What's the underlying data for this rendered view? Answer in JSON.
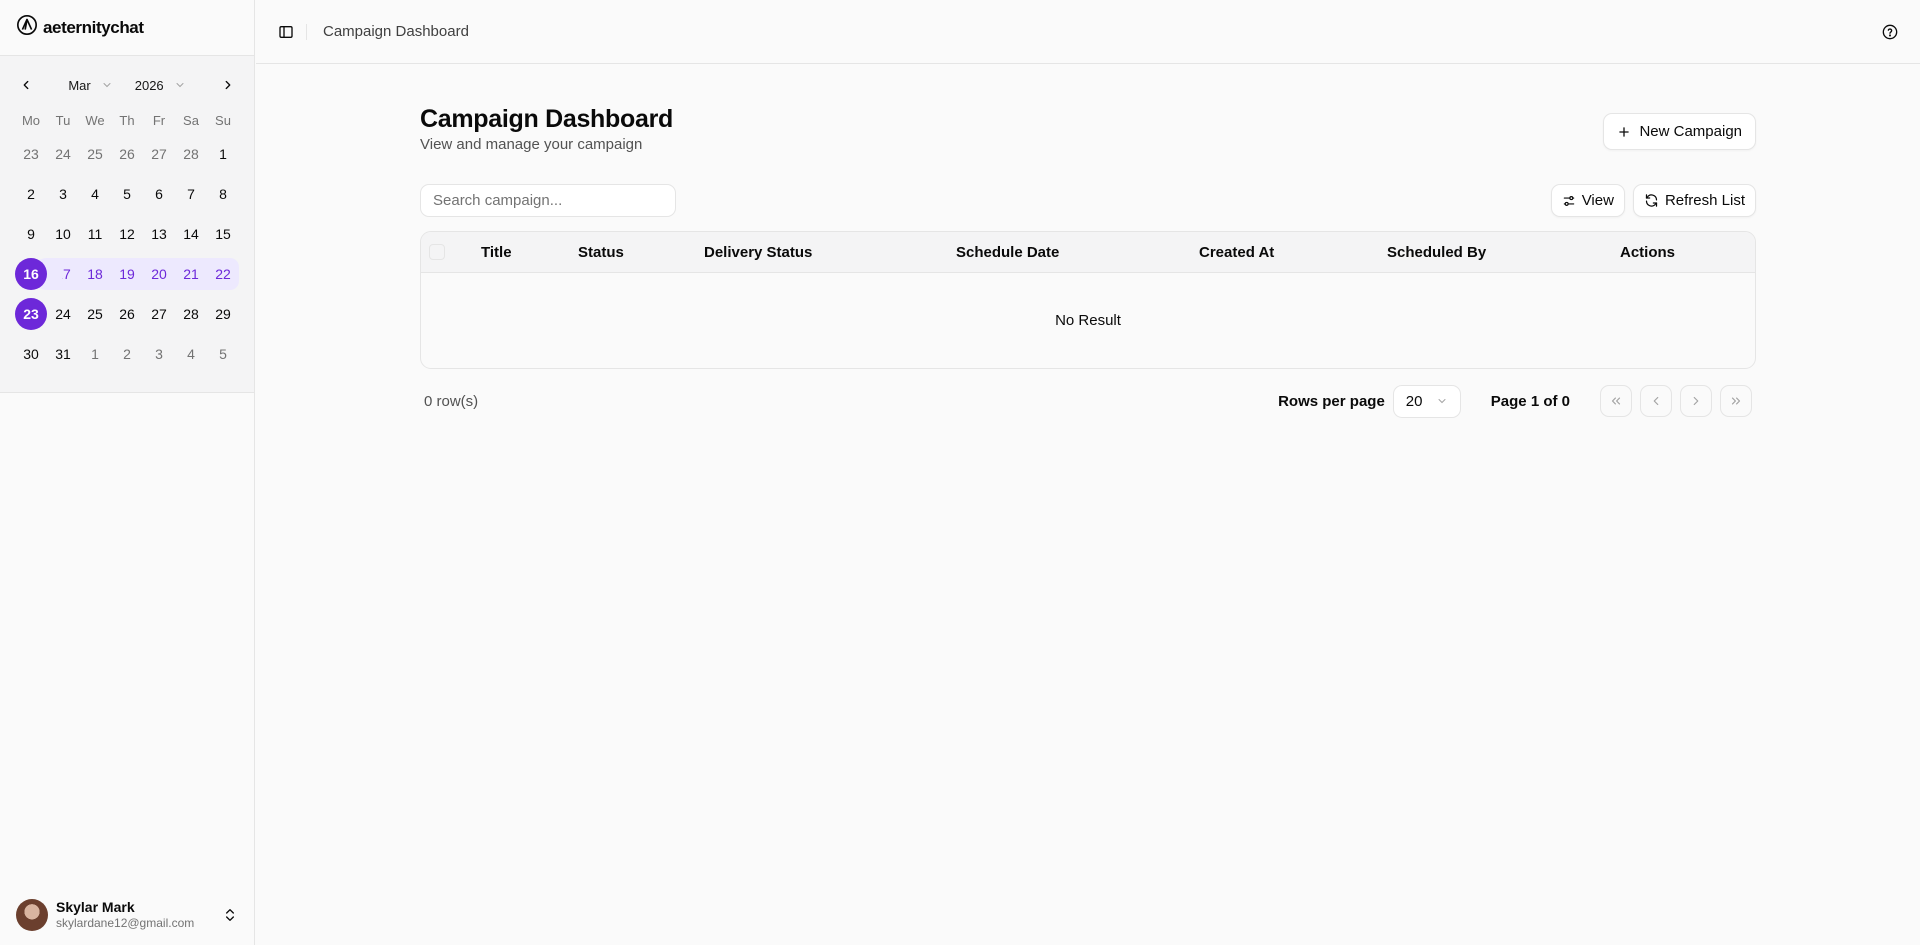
{
  "brand": {
    "name": "aeternitychat"
  },
  "calendar": {
    "month": "Mar",
    "year": "2026",
    "weekdays": [
      "Mo",
      "Tu",
      "We",
      "Th",
      "Fr",
      "Sa",
      "Su"
    ],
    "days": [
      {
        "d": "23",
        "t": "muted"
      },
      {
        "d": "24",
        "t": "muted"
      },
      {
        "d": "25",
        "t": "muted"
      },
      {
        "d": "26",
        "t": "muted"
      },
      {
        "d": "27",
        "t": "muted"
      },
      {
        "d": "28",
        "t": "muted"
      },
      {
        "d": "1",
        "t": ""
      },
      {
        "d": "2",
        "t": ""
      },
      {
        "d": "3",
        "t": ""
      },
      {
        "d": "4",
        "t": ""
      },
      {
        "d": "5",
        "t": ""
      },
      {
        "d": "6",
        "t": ""
      },
      {
        "d": "7",
        "t": ""
      },
      {
        "d": "8",
        "t": ""
      },
      {
        "d": "9",
        "t": ""
      },
      {
        "d": "10",
        "t": ""
      },
      {
        "d": "11",
        "t": ""
      },
      {
        "d": "12",
        "t": ""
      },
      {
        "d": "13",
        "t": ""
      },
      {
        "d": "14",
        "t": ""
      },
      {
        "d": "15",
        "t": ""
      },
      {
        "d": "16",
        "t": "sel range-start"
      },
      {
        "d": "17",
        "t": "range"
      },
      {
        "d": "18",
        "t": "range"
      },
      {
        "d": "19",
        "t": "range"
      },
      {
        "d": "20",
        "t": "range"
      },
      {
        "d": "21",
        "t": "range"
      },
      {
        "d": "22",
        "t": "range range-end"
      },
      {
        "d": "23",
        "t": "sel"
      },
      {
        "d": "24",
        "t": ""
      },
      {
        "d": "25",
        "t": ""
      },
      {
        "d": "26",
        "t": ""
      },
      {
        "d": "27",
        "t": ""
      },
      {
        "d": "28",
        "t": ""
      },
      {
        "d": "29",
        "t": ""
      },
      {
        "d": "30",
        "t": ""
      },
      {
        "d": "31",
        "t": ""
      },
      {
        "d": "1",
        "t": "muted"
      },
      {
        "d": "2",
        "t": "muted"
      },
      {
        "d": "3",
        "t": "muted"
      },
      {
        "d": "4",
        "t": "muted"
      },
      {
        "d": "5",
        "t": "muted"
      }
    ]
  },
  "user": {
    "name": "Skylar Mark",
    "email": "skylardane12@gmail.com"
  },
  "topbar": {
    "breadcrumb": "Campaign Dashboard"
  },
  "page": {
    "title": "Campaign Dashboard",
    "subtitle": "View and manage your campaign",
    "new_button": "New Campaign"
  },
  "toolbar": {
    "search_placeholder": "Search campaign...",
    "view_label": "View",
    "refresh_label": "Refresh List"
  },
  "table": {
    "columns": [
      "Title",
      "Status",
      "Delivery Status",
      "Schedule Date",
      "Created At",
      "Scheduled By",
      "Actions"
    ],
    "empty_text": "No Result"
  },
  "footer": {
    "row_count": "0 row(s)",
    "rows_per_page_label": "Rows per page",
    "rows_per_page_value": "20",
    "page_info": "Page 1 of 0"
  },
  "colors": {
    "accent": "#6d28d9",
    "accent_light": "#ede9fe",
    "border": "#e5e5e5"
  }
}
